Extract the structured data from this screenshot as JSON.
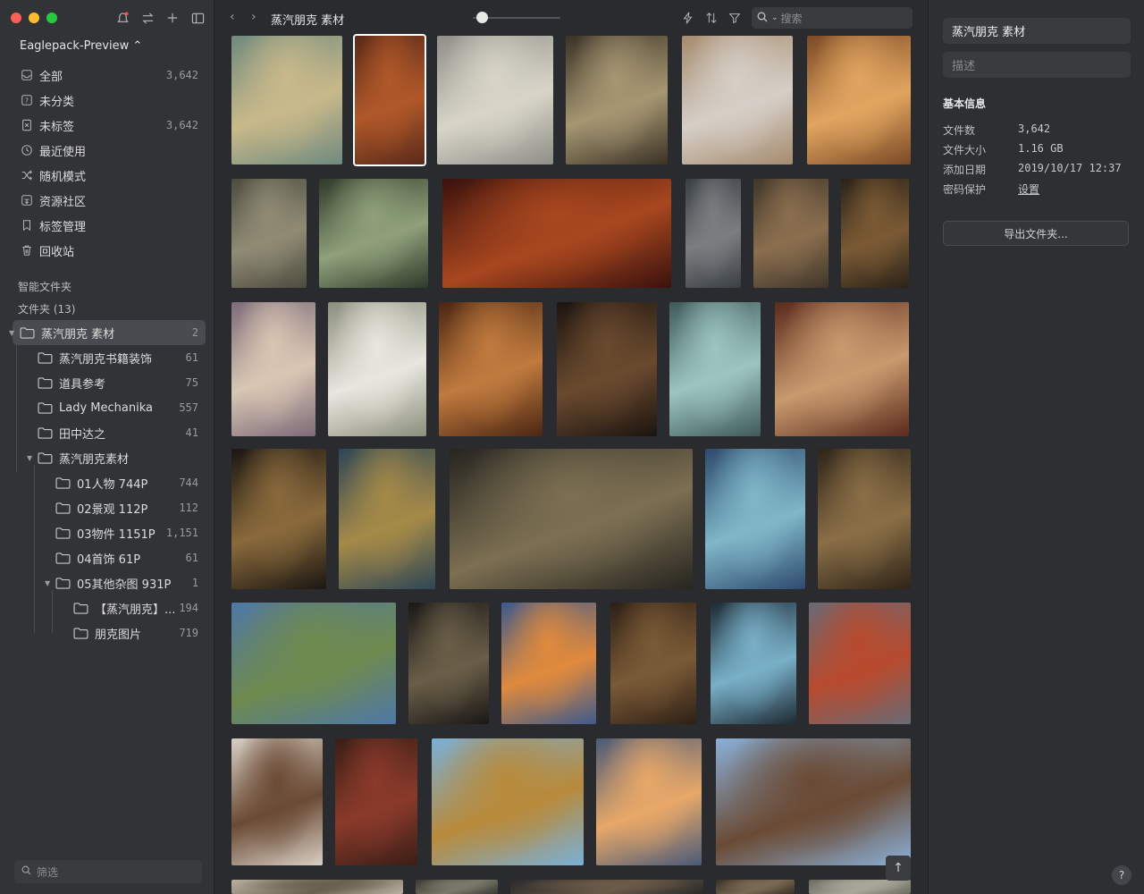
{
  "window": {
    "library_name": "Eaglepack-Preview ⌃"
  },
  "nav": [
    {
      "label": "全部",
      "count": "3,642",
      "icon": "inbox-icon"
    },
    {
      "label": "未分类",
      "count": "",
      "icon": "unknown-icon"
    },
    {
      "label": "未标签",
      "count": "3,642",
      "icon": "untagged-icon"
    },
    {
      "label": "最近使用",
      "count": "",
      "icon": "clock-icon"
    },
    {
      "label": "随机模式",
      "count": "",
      "icon": "shuffle-icon"
    },
    {
      "label": "资源社区",
      "count": "",
      "icon": "community-icon"
    },
    {
      "label": "标签管理",
      "count": "",
      "icon": "bookmark-icon"
    },
    {
      "label": "回收站",
      "count": "",
      "icon": "trash-icon"
    }
  ],
  "sections": {
    "smart_folders": "智能文件夹",
    "folders": "文件夹 (13)"
  },
  "tree": [
    {
      "label": "蒸汽朋克 素材",
      "count": "2",
      "level": 0,
      "selected": true,
      "expanded": true
    },
    {
      "label": "蒸汽朋克书籍装饰",
      "count": "61",
      "level": 1
    },
    {
      "label": "道具参考",
      "count": "75",
      "level": 1
    },
    {
      "label": "Lady Mechanika",
      "count": "557",
      "level": 1
    },
    {
      "label": "田中达之",
      "count": "41",
      "level": 1
    },
    {
      "label": "蒸汽朋克素材",
      "count": "",
      "level": 1,
      "expanded": true
    },
    {
      "label": "01人物 744P",
      "count": "744",
      "level": 2
    },
    {
      "label": "02景观 112P",
      "count": "112",
      "level": 2
    },
    {
      "label": "03物件 1151P",
      "count": "1,151",
      "level": 2
    },
    {
      "label": "04首饰 61P",
      "count": "61",
      "level": 2
    },
    {
      "label": "05其他杂图 931P",
      "count": "1",
      "level": 2,
      "expanded": true
    },
    {
      "label": "【蒸汽朋克】...",
      "count": "194",
      "level": 3
    },
    {
      "label": "朋克图片",
      "count": "719",
      "level": 3
    }
  ],
  "filter": {
    "placeholder": "筛选"
  },
  "main": {
    "title": "蒸汽朋克 素材",
    "search_placeholder": "搜索",
    "zoom": 0.1
  },
  "thumbs": [
    {
      "c1": "#6f8a7e",
      "c2": "#c9b98a"
    },
    {
      "c1": "#5a2a18",
      "c2": "#b0582a",
      "selected": true
    },
    {
      "c1": "#8f8f88",
      "c2": "#d8d5c8"
    },
    {
      "c1": "#3b3226",
      "c2": "#a69772"
    },
    {
      "c1": "#a58b6e",
      "c2": "#d6cfc7"
    },
    {
      "c1": "#7a4a26",
      "c2": "#e2a560"
    },
    {
      "c1": "#4d4b3e",
      "c2": "#8f8b75"
    },
    {
      "c1": "#2f3a2a",
      "c2": "#8fa07a"
    },
    {
      "c1": "#3b120d",
      "c2": "#a8471f"
    },
    {
      "c1": "#3a3f44",
      "c2": "#7b7e80"
    },
    {
      "c1": "#40362a",
      "c2": "#8a6e4e"
    },
    {
      "c1": "#2a2218",
      "c2": "#7a5a34"
    },
    {
      "c1": "#7d6a78",
      "c2": "#d9c7b4"
    },
    {
      "c1": "#8c8f7c",
      "c2": "#e8e6de"
    },
    {
      "c1": "#4b2612",
      "c2": "#c07a3e"
    },
    {
      "c1": "#1c1410",
      "c2": "#6a4a2e"
    },
    {
      "c1": "#3f5a58",
      "c2": "#9cc5c0"
    },
    {
      "c1": "#5a2a1c",
      "c2": "#c99a6e"
    },
    {
      "c1": "#1a1612",
      "c2": "#8a6a3c"
    },
    {
      "c1": "#2e4656",
      "c2": "#a58a48"
    },
    {
      "c1": "#262520",
      "c2": "#7c6f52"
    },
    {
      "c1": "#2e4a6e",
      "c2": "#7fb7c8"
    },
    {
      "c1": "#2e2418",
      "c2": "#8a6e46"
    },
    {
      "c1": "#4e78a6",
      "c2": "#6f8a4e"
    },
    {
      "c1": "#1a1816",
      "c2": "#6a5e48"
    },
    {
      "c1": "#3e5a8c",
      "c2": "#e08a3c"
    },
    {
      "c1": "#2e2016",
      "c2": "#7a5a36"
    },
    {
      "c1": "#1e2a34",
      "c2": "#78b0c8"
    },
    {
      "c1": "#6a6a74",
      "c2": "#b84a2e"
    },
    {
      "c1": "#d8cfc4",
      "c2": "#6a4a34"
    },
    {
      "c1": "#3a1e16",
      "c2": "#8a3a2a"
    },
    {
      "c1": "#7ab0d8",
      "c2": "#b88a3a"
    },
    {
      "c1": "#4a5a78",
      "c2": "#e8a868"
    },
    {
      "c1": "#8ab0d8",
      "c2": "#6a4a34"
    },
    {
      "c1": "#b8b0a0",
      "c2": "#6a6050"
    },
    {
      "c1": "#3a3a34",
      "c2": "#7a7a6a"
    },
    {
      "c1": "#2a2a2a",
      "c2": "#6a5a48"
    },
    {
      "c1": "#3a3026",
      "c2": "#7a6a54"
    },
    {
      "c1": "#6a6a62",
      "c2": "#a8a89a"
    },
    {
      "c1": "#3a2a22",
      "c2": "#7a4a34"
    }
  ],
  "panel": {
    "title": "蒸汽朋克 素材",
    "desc_placeholder": "描述",
    "section": "基本信息",
    "rows": [
      {
        "k": "文件数",
        "v": "3,642"
      },
      {
        "k": "文件大小",
        "v": "1.16 GB"
      },
      {
        "k": "添加日期",
        "v": "2019/10/17 12:37"
      },
      {
        "k": "密码保护",
        "v": "设置"
      }
    ],
    "export": "导出文件夹...",
    "help": "?"
  }
}
